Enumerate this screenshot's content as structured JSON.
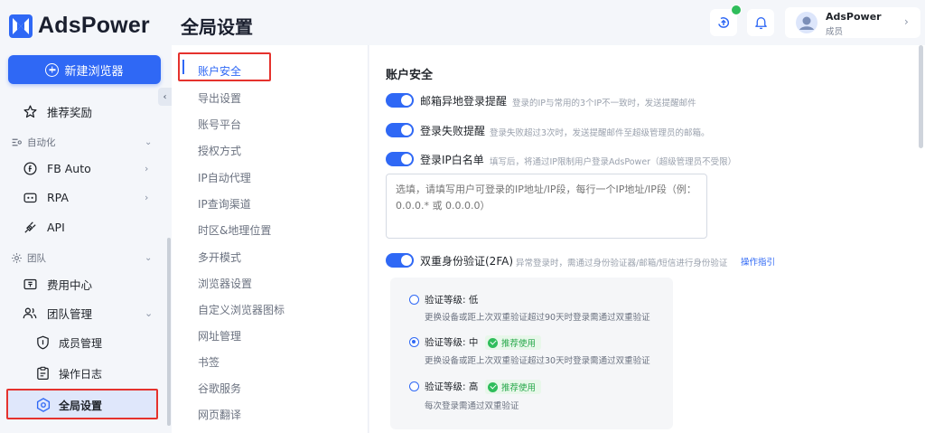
{
  "app": {
    "name": "AdsPower"
  },
  "sidebar": {
    "new_browser_label": "新建浏览器",
    "collapse_glyph": "‹",
    "rewards_label": "推荐奖励",
    "automation_group": "自动化",
    "fb_auto_label": "FB Auto",
    "rpa_label": "RPA",
    "api_label": "API",
    "team_group": "团队",
    "billing_label": "费用中心",
    "team_mgmt_label": "团队管理",
    "members_label": "成员管理",
    "logs_label": "操作日志",
    "global_settings_label": "全局设置"
  },
  "header": {
    "title": "全局设置",
    "user": {
      "name": "AdsPower",
      "role": "成员"
    }
  },
  "settings_menu": {
    "items": [
      "账户安全",
      "导出设置",
      "账号平台",
      "授权方式",
      "IP自动代理",
      "IP查询渠道",
      "时区&地理位置",
      "多开模式",
      "浏览器设置",
      "自定义浏览器图标",
      "网址管理",
      "书签",
      "谷歌服务",
      "网页翻译"
    ],
    "active_index": 0
  },
  "content": {
    "section_title": "账户安全",
    "options": [
      {
        "label": "邮箱异地登录提醒",
        "desc": "登录的IP与常用的3个IP不一致时，发送提醒邮件",
        "enabled": true
      },
      {
        "label": "登录失败提醒",
        "desc": "登录失败超过3次时，发送提醒邮件至超级管理员的邮箱。",
        "enabled": true
      },
      {
        "label": "登录IP白名单",
        "desc": "填写后，将通过IP限制用户登录AdsPower（超级管理员不受限）",
        "enabled": true
      },
      {
        "label": "双重身份验证(2FA)",
        "desc": "异常登录时，需通过身份验证器/邮箱/短信进行身份验证",
        "enabled": true
      }
    ],
    "ip_whitelist_placeholder": "选填，请填写用户可登录的IP地址/IP段，每行一个IP地址/IP段（例：0.0.0.* 或 0.0.0.0）",
    "guide_link": "操作指引",
    "recommended_tag": "推荐使用",
    "levels": [
      {
        "label": "验证等级: 低",
        "desc": "更换设备或距上次双重验证超过90天时登录需通过双重验证",
        "checked": false,
        "recommended": false
      },
      {
        "label": "验证等级: 中",
        "desc": "更换设备或距上次双重验证超过30天时登录需通过双重验证",
        "checked": true,
        "recommended": true
      },
      {
        "label": "验证等级: 高",
        "desc": "每次登录需通过双重验证",
        "checked": false,
        "recommended": true
      }
    ]
  },
  "colors": {
    "accent": "#2f68f5",
    "highlight": "#e5322d",
    "success": "#2fbd5b"
  }
}
